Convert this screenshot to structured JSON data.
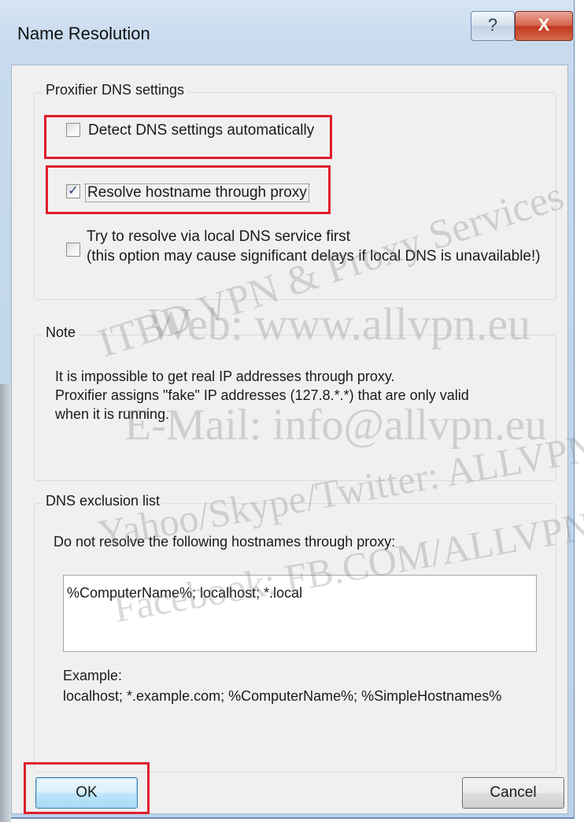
{
  "window": {
    "title": "Name Resolution",
    "help_glyph": "?",
    "close_glyph": "X"
  },
  "dns_settings": {
    "group_title": "Proxifier DNS settings",
    "detect_label": "Detect DNS settings automatically",
    "detect_checked": false,
    "resolve_proxy_label": "Resolve hostname through proxy",
    "resolve_proxy_checked": true,
    "local_first_label_1": "Try to resolve via local DNS service first",
    "local_first_label_2": "(this option may cause significant delays if local DNS is unavailable!)",
    "local_first_checked": false,
    "check_glyph": "✓"
  },
  "note": {
    "group_title": "Note",
    "line1": "It is impossible to get real IP addresses through proxy.",
    "line2": "Proxifier assigns \"fake\" IP addresses (127.8.*.*) that are only valid",
    "line3": "when it is running."
  },
  "exclusion": {
    "group_title": "DNS exclusion list",
    "instruction": "Do not resolve the following hostnames through proxy:",
    "hosts_value": "%ComputerName%; localhost; *.local",
    "example_label": "Example:",
    "example_text": "localhost; *.example.com; %ComputerName%; %SimpleHostnames%"
  },
  "buttons": {
    "ok": "OK",
    "cancel": "Cancel"
  },
  "watermark": {
    "line1": "ITBD VPN & Proxy Services",
    "line2": "Web: www.allvpn.eu",
    "line3": "E-Mail: info@allvpn.eu",
    "line4": "Yahoo/Skype/Twitter: ALLVPN",
    "line5": "Facebook: FB.COM/ALLVPN"
  },
  "colors": {
    "highlight": "#e01d2b",
    "dialog_bg": "#f0f0f0",
    "titlebar": "#c7daee"
  }
}
